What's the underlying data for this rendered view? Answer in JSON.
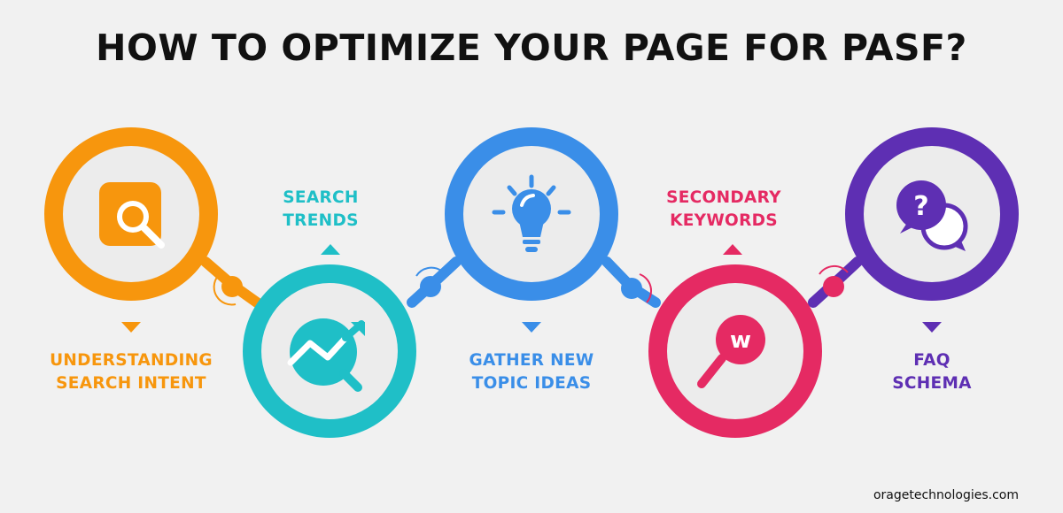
{
  "title": "HOW TO OPTIMIZE YOUR PAGE FOR PASF?",
  "steps": [
    {
      "lines": [
        "UNDERSTANDING",
        "SEARCH INTENT"
      ],
      "color": "#f7960d",
      "icon": "magnifier-icon"
    },
    {
      "lines": [
        "SEARCH",
        "TRENDS"
      ],
      "color": "#1fbfc7",
      "icon": "trending-chart-icon"
    },
    {
      "lines": [
        "GATHER NEW",
        "TOPIC IDEAS"
      ],
      "color": "#3a8ee8",
      "icon": "lightbulb-icon"
    },
    {
      "lines": [
        "SECONDARY",
        "KEYWORDS"
      ],
      "color": "#e52a63",
      "icon": "keyword-search-icon"
    },
    {
      "lines": [
        "FAQ",
        "SCHEMA"
      ],
      "color": "#5e2fb3",
      "icon": "question-chat-icon"
    }
  ],
  "footer": "oragetechnologies.com"
}
